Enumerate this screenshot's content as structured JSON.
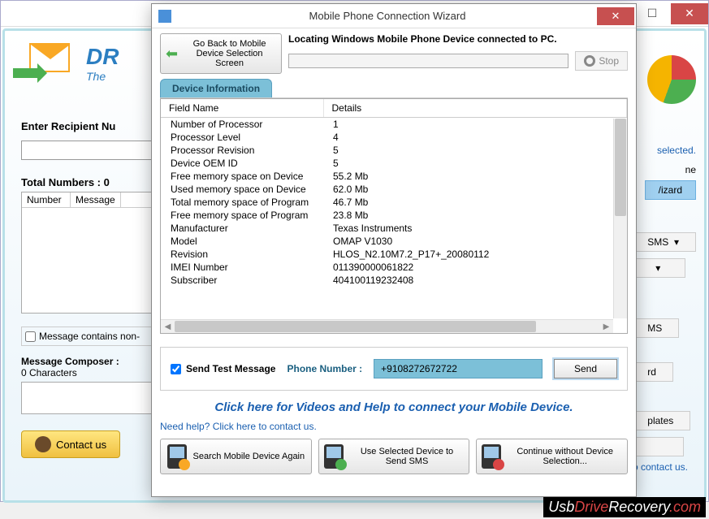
{
  "app": {
    "logo_text": "DR",
    "logo_sub": "The",
    "recipient_label": "Enter Recipient Nu",
    "total_label": "Total Numbers : 0",
    "table_col_number": "Number",
    "table_col_message": "Message",
    "msg_contains": "Message contains non-",
    "composer_label": "Message Composer :",
    "composer_sub": "0 Characters",
    "contact_btn": "Contact us",
    "right_selected": "selected.",
    "right_ne": "ne",
    "right_wizard": "/izard",
    "right_sms": "SMS",
    "right_sms2": "MS",
    "right_rd": "rd",
    "right_plates": "plates",
    "need_help": "Need help? Click here to contact us."
  },
  "wizard": {
    "title": "Mobile Phone Connection Wizard",
    "goback": "Go Back to Mobile Device Selection Screen",
    "locating": "Locating Windows Mobile Phone Device connected to PC.",
    "stop": "Stop",
    "tab": "Device Information",
    "col_field": "Field Name",
    "col_details": "Details",
    "rows": [
      {
        "f": "Number of Processor",
        "d": "1"
      },
      {
        "f": "Processor Level",
        "d": "4"
      },
      {
        "f": "Processor Revision",
        "d": "5"
      },
      {
        "f": "Device OEM ID",
        "d": "5"
      },
      {
        "f": "Free memory space on Device",
        "d": "55.2 Mb"
      },
      {
        "f": "Used memory space on Device",
        "d": "62.0 Mb"
      },
      {
        "f": "Total memory space of Program",
        "d": "46.7 Mb"
      },
      {
        "f": "Free memory space of Program",
        "d": "23.8 Mb"
      },
      {
        "f": "Manufacturer",
        "d": "Texas Instruments"
      },
      {
        "f": "Model",
        "d": "OMAP V1030"
      },
      {
        "f": "Revision",
        "d": "HLOS_N2.10M7.2_P17+_20080112"
      },
      {
        "f": "IMEI Number",
        "d": "011390000061822"
      },
      {
        "f": "Subscriber",
        "d": "404100119232408"
      }
    ],
    "send_test": "Send Test Message",
    "phone_label": "Phone Number :",
    "phone_value": "+9108272672722",
    "send": "Send",
    "video_link": "Click here for Videos and Help to connect your Mobile Device.",
    "contact_link": "Need help? Click here to contact us.",
    "btn_search": "Search Mobile Device Again",
    "btn_use": "Use Selected Device to Send SMS",
    "btn_continue": "Continue without Device Selection..."
  },
  "branding": {
    "usb": "Usb",
    "drive": "Drive",
    "rec": "Recovery",
    "com": ".com"
  }
}
